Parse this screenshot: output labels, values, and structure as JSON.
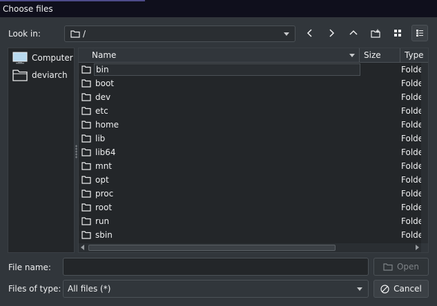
{
  "window": {
    "title": "Choose files"
  },
  "toolbar": {
    "look_in_label": "Look in:",
    "path": "/",
    "icons": [
      "back-icon",
      "forward-icon",
      "up-icon",
      "new-folder-icon",
      "icon-view-icon",
      "detail-view-icon"
    ]
  },
  "sidebar": {
    "items": [
      {
        "label": "Computer",
        "icon": "computer-icon"
      },
      {
        "label": "deviarch",
        "icon": "folder-icon"
      }
    ]
  },
  "file_list": {
    "columns": [
      "Name",
      "Size",
      "Type"
    ],
    "rows": [
      {
        "name": "bin",
        "type": "Folder"
      },
      {
        "name": "boot",
        "type": "Folder"
      },
      {
        "name": "dev",
        "type": "Folder"
      },
      {
        "name": "etc",
        "type": "Folder"
      },
      {
        "name": "home",
        "type": "Folder"
      },
      {
        "name": "lib",
        "type": "Folder"
      },
      {
        "name": "lib64",
        "type": "Folder"
      },
      {
        "name": "mnt",
        "type": "Folder"
      },
      {
        "name": "opt",
        "type": "Folder"
      },
      {
        "name": "proc",
        "type": "Folder"
      },
      {
        "name": "root",
        "type": "Folder"
      },
      {
        "name": "run",
        "type": "Folder"
      },
      {
        "name": "sbin",
        "type": "Folder"
      }
    ]
  },
  "footer": {
    "file_name_label": "File name:",
    "file_name_value": "",
    "files_of_type_label": "Files of type:",
    "files_of_type_value": "All files (*)",
    "open_label": "Open",
    "cancel_label": "Cancel"
  },
  "colors": {
    "accent": "#4d4b8a",
    "background": "#31363b",
    "view": "#232629"
  }
}
